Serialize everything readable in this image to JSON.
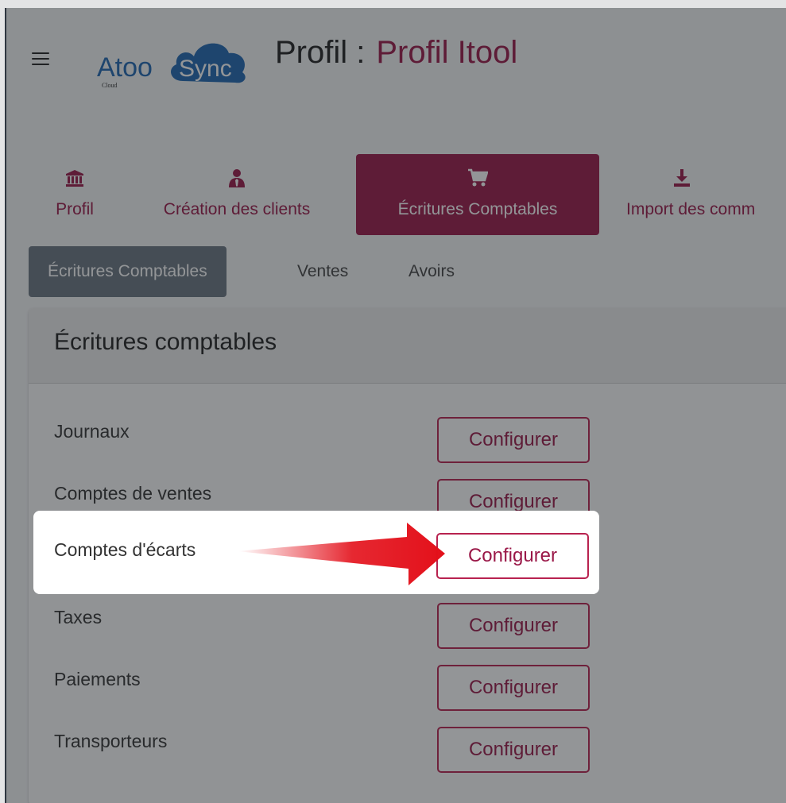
{
  "header": {
    "logo": {
      "text_atoo": "Atoo",
      "text_sync": "Sync",
      "text_cloud": "Cloud"
    },
    "title_prefix": "Profil :",
    "title_value": "Profil Itool"
  },
  "main_tabs": [
    {
      "label": "Profil",
      "icon": "bank-icon",
      "active": false
    },
    {
      "label": "Création des clients",
      "icon": "user-tie-icon",
      "active": false
    },
    {
      "label": "Écritures Comptables",
      "icon": "cart-icon",
      "active": true
    },
    {
      "label": "Import des comm",
      "icon": "download-icon",
      "active": false
    }
  ],
  "sub_tabs": [
    {
      "label": "Écritures Comptables",
      "active": true
    },
    {
      "label": "Ventes",
      "active": false
    },
    {
      "label": "Avoirs",
      "active": false
    }
  ],
  "card": {
    "title": "Écritures comptables",
    "rows": [
      {
        "label": "Journaux",
        "button": "Configurer"
      },
      {
        "label": "Comptes de ventes",
        "button": "Configurer"
      },
      {
        "label": "Comptes d'écarts",
        "button": "Configurer"
      },
      {
        "label": "Taxes",
        "button": "Configurer"
      },
      {
        "label": "Paiements",
        "button": "Configurer"
      },
      {
        "label": "Transporteurs",
        "button": "Configurer"
      }
    ]
  },
  "colors": {
    "brand": "#9a1848",
    "logo_blue": "#1f67b1",
    "active_subtab": "#6a7580",
    "arrow": "#e3101a"
  }
}
